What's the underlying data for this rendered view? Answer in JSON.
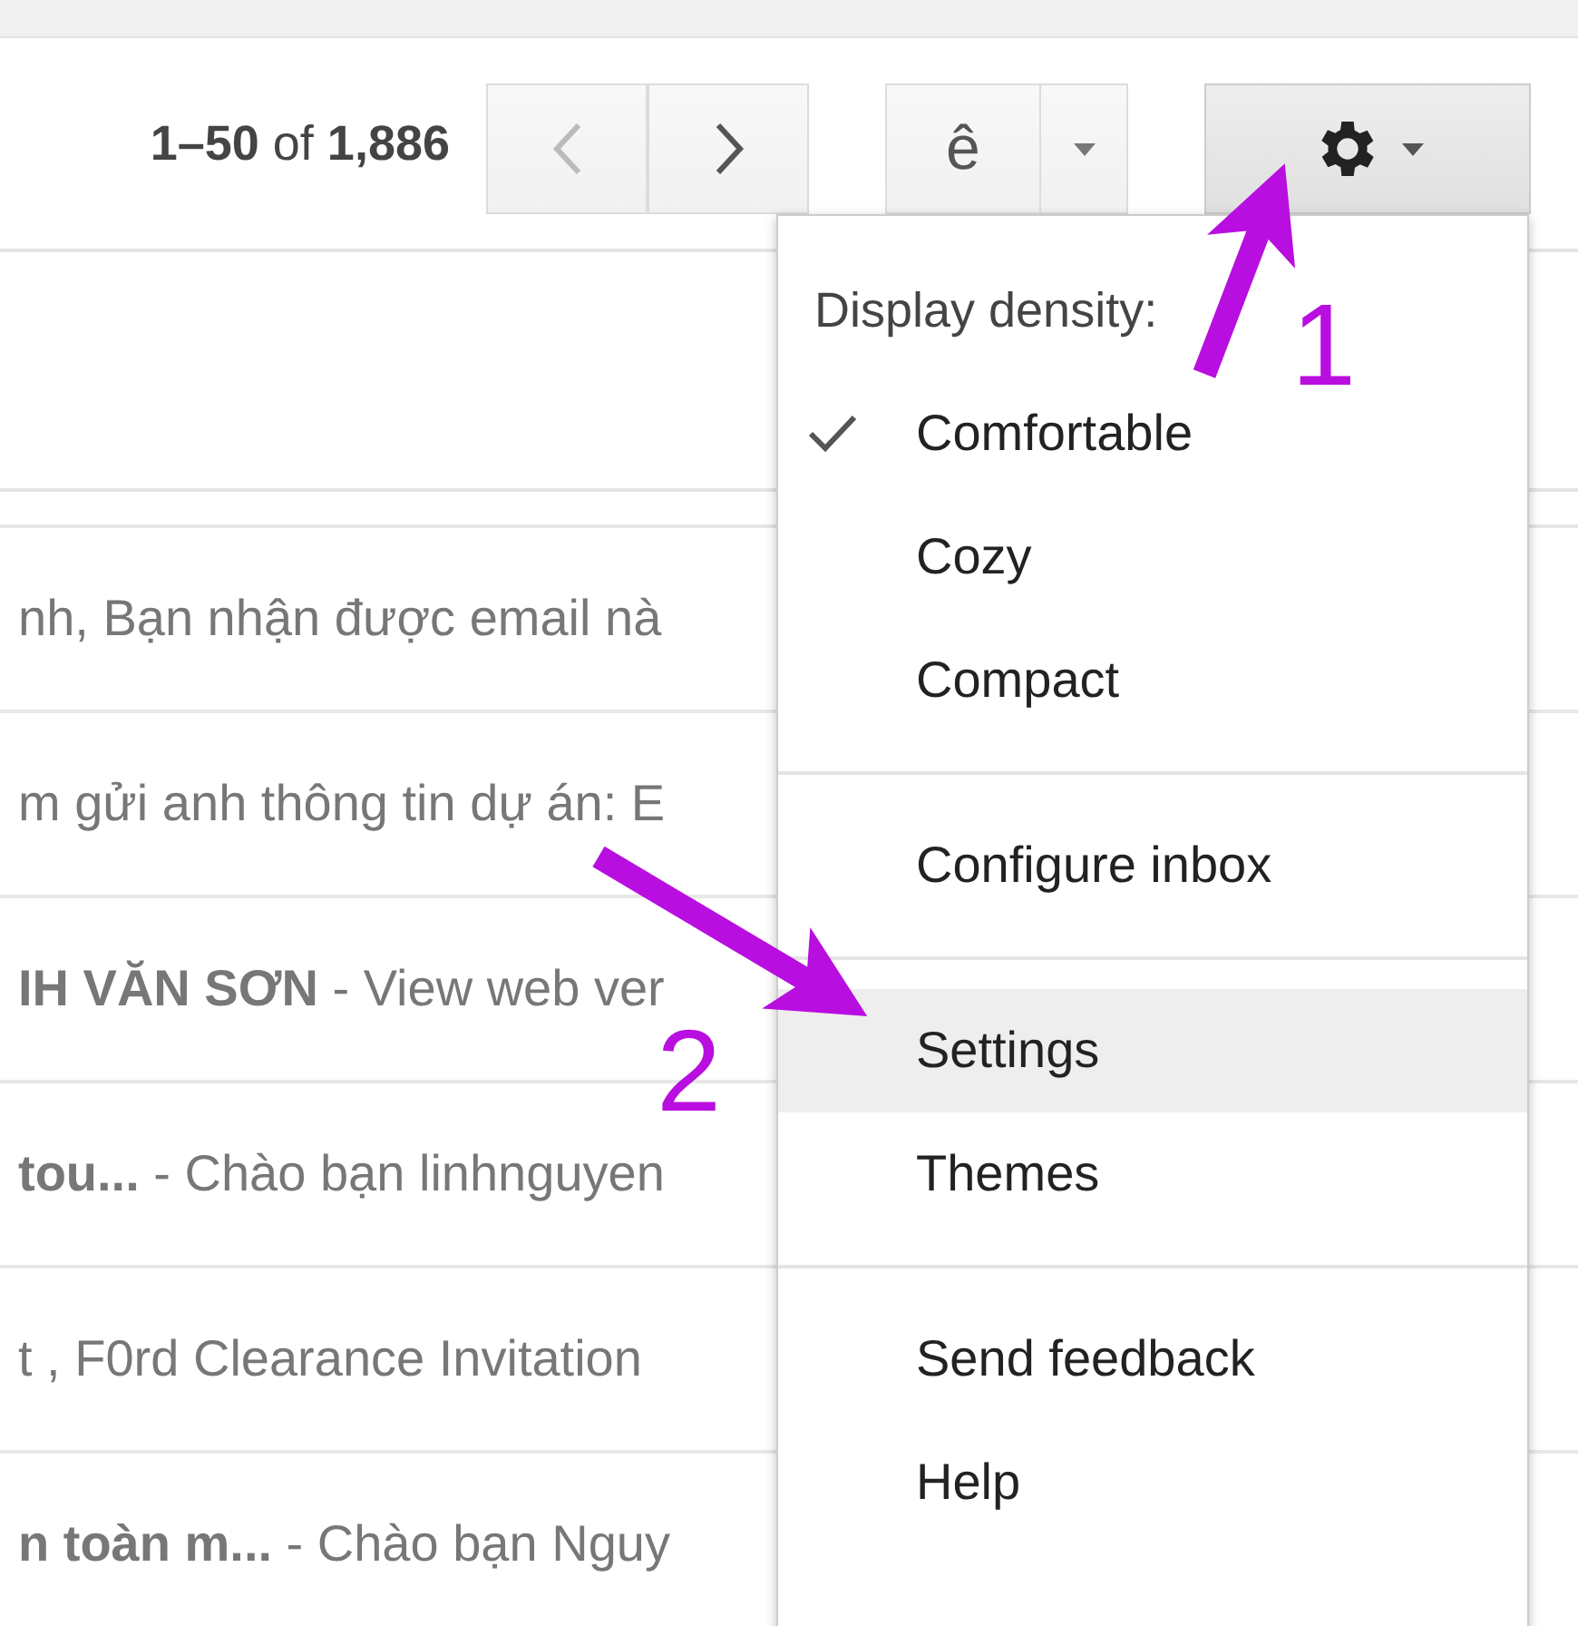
{
  "toolbar": {
    "counter": "**1–50** of **1,886**",
    "input_tool": "ê"
  },
  "email_rows": [
    {
      "text": "nh, Bạn nhận được email nà"
    },
    {
      "text": "m gửi anh thông tin dự án: E"
    },
    {
      "text": "**IH VĂN SƠN** - View web ver"
    },
    {
      "text": "**tou...** - Chào bạn linhnguyen"
    },
    {
      "text": "t , F0rd Clearance Invitation"
    },
    {
      "text": "**n toàn m...** - Chào bạn Nguy"
    }
  ],
  "settings_menu": {
    "items": [
      {
        "kind": "header",
        "label": "Display density:"
      },
      {
        "kind": "option",
        "label": "Comfortable",
        "checked": true
      },
      {
        "kind": "option",
        "label": "Cozy",
        "checked": false
      },
      {
        "kind": "option",
        "label": "Compact",
        "checked": false
      },
      {
        "kind": "divider"
      },
      {
        "kind": "action",
        "label": "Configure inbox",
        "selected": false
      },
      {
        "kind": "divider"
      },
      {
        "kind": "action",
        "label": "Settings",
        "selected": true
      },
      {
        "kind": "action",
        "label": "Themes",
        "selected": false
      },
      {
        "kind": "divider"
      },
      {
        "kind": "action",
        "label": "Send feedback",
        "selected": false
      },
      {
        "kind": "action",
        "label": "Help",
        "selected": false
      }
    ]
  },
  "annotations": [
    {
      "label": "1"
    },
    {
      "label": "2"
    }
  ]
}
